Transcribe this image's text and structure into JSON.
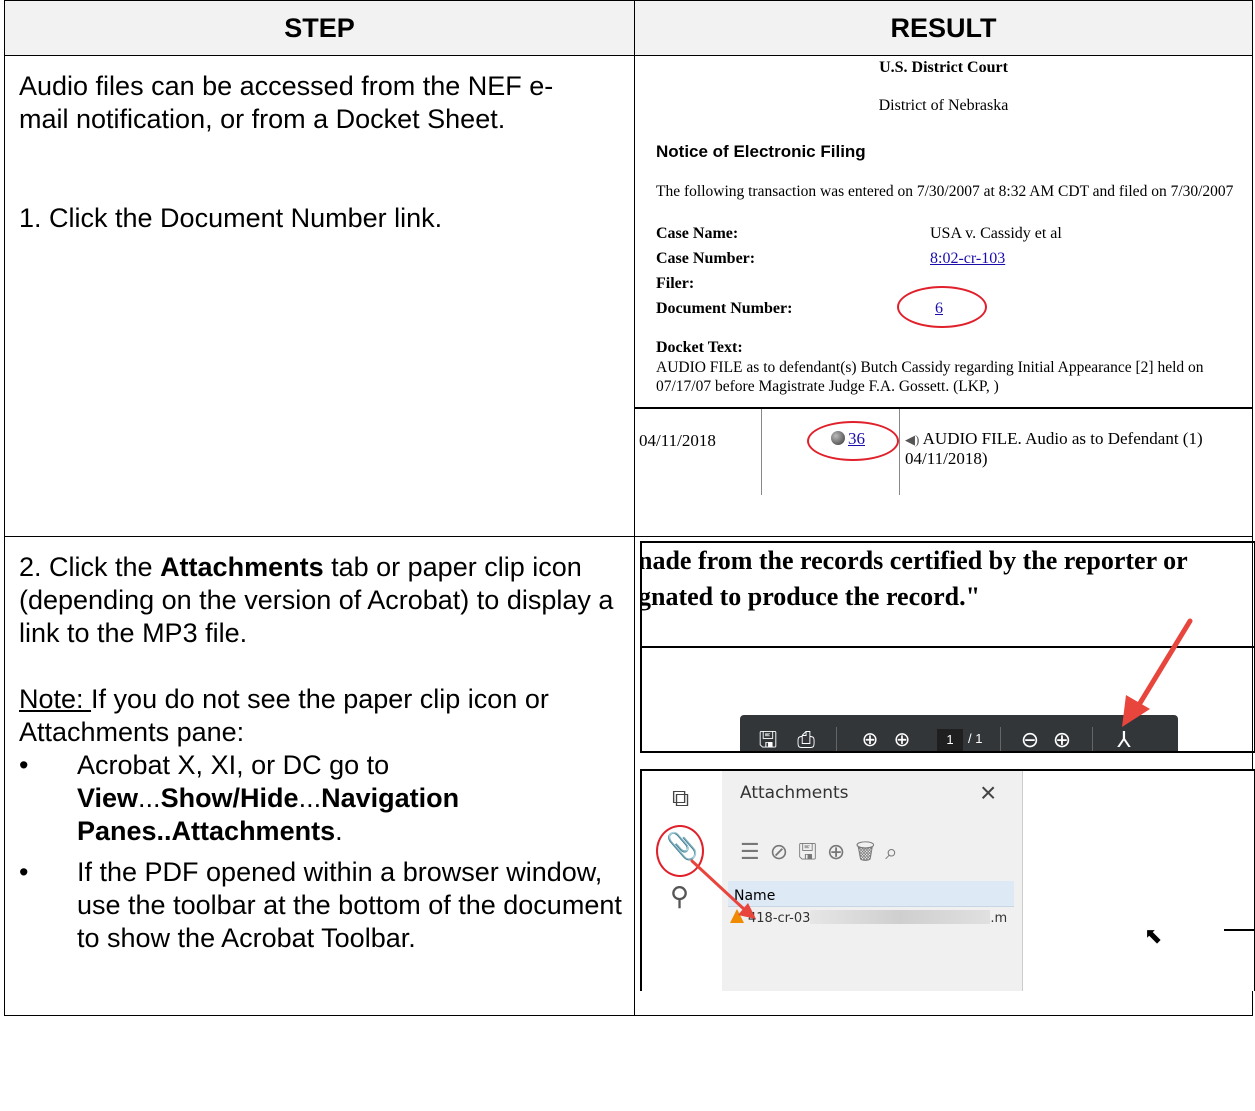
{
  "header": {
    "step": "STEP",
    "result": "RESULT"
  },
  "row1": {
    "intro": "Audio files can be accessed from the NEF e-mail notification, or from a Docket Sheet.",
    "step1": "1.  Click the Document Number link.",
    "nef": {
      "court": "U.S. District Court",
      "district": "District of Nebraska",
      "notice": "Notice of Electronic Filing",
      "transaction": "The following transaction was entered on 7/30/2007 at 8:32 AM CDT and filed on 7/30/2007",
      "fields": [
        {
          "label": "Case Name:",
          "value": "USA v. Cassidy et al"
        },
        {
          "label": "Case Number:",
          "value": "8:02-cr-103"
        },
        {
          "label": "Filer:",
          "value": ""
        },
        {
          "label": "Document Number:",
          "value": "6"
        }
      ],
      "docket_label": "Docket Text:",
      "docket_text": "AUDIO FILE as to defendant(s) Butch Cassidy regarding Initial Appearance [2] held on 07/17/07 before Magistrate Judge F.A. Gossett. (LKP, )"
    },
    "docket": {
      "date": "04/11/2018",
      "number": "36",
      "text": "AUDIO FILE. Audio as to Defendant (1) 04/11/2018)"
    }
  },
  "row2": {
    "step_pre": "2. Click the ",
    "step_bold": "Attachments",
    "step_post": " tab or paper clip icon (depending on the version of Acrobat) to display a link to the MP3 file.",
    "note_label": "Note: ",
    "note_text": "If you do not see the paper clip icon or Attachments pane:",
    "bullet1_pre": "Acrobat X, XI, or DC go to ",
    "bullet1_b1": "View",
    "bullet1_d1": "...",
    "bullet1_b2": "Show/Hide",
    "bullet1_d2": "...",
    "bullet1_b3": "Navigation Panes..Attachments",
    "bullet1_end": ".",
    "bullet2": "If the PDF opened within a browser window, use the toolbar at the bottom of the document to show the Acrobat Toolbar.",
    "pdf_line1": "nade from the records certified by the reporter or",
    "pdf_line2": "gnated to produce the record.\"",
    "toolbar": {
      "page": "1",
      "total": "/ 1"
    },
    "attachments": {
      "title": "Attachments",
      "column": "Name",
      "file_start": "418-cr-03",
      "file_end": ".m"
    }
  }
}
